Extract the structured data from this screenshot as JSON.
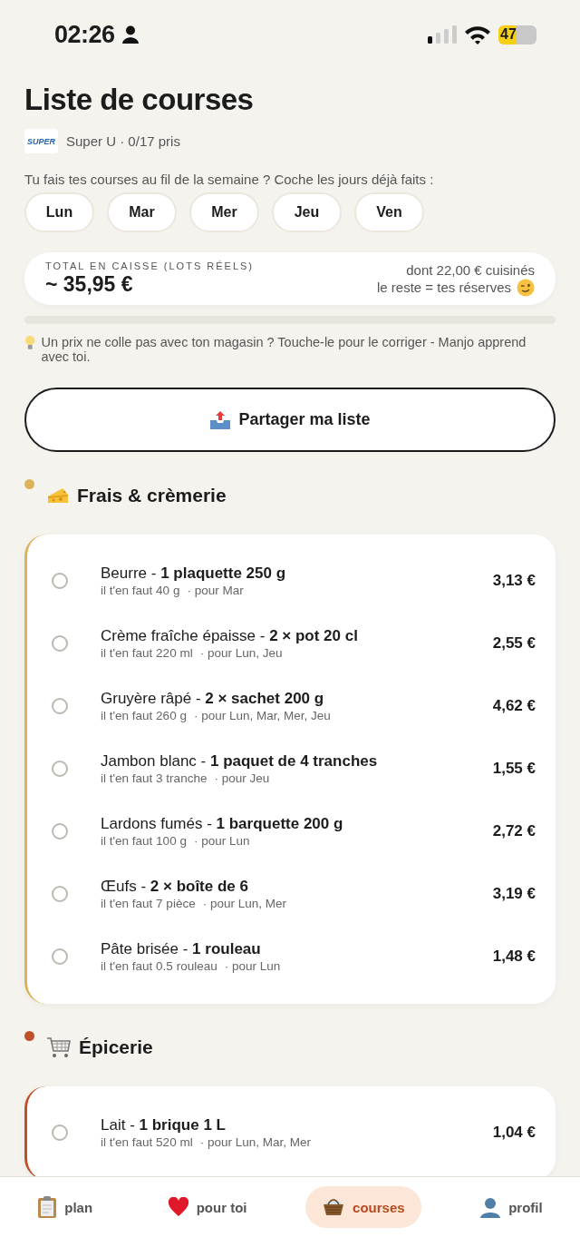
{
  "status_bar": {
    "time": "02:26",
    "battery": "47"
  },
  "title": "Liste de courses",
  "store": {
    "logo": "SUPER",
    "subtitle": "Super U · 0/17 pris"
  },
  "days_prompt": "Tu fais tes courses au fil de la semaine ? Coche les jours déjà faits :",
  "days": [
    {
      "label": "Lun",
      "selected": false
    },
    {
      "label": "Mar",
      "selected": false
    },
    {
      "label": "Mer",
      "selected": false
    },
    {
      "label": "Jeu",
      "selected": false
    },
    {
      "label": "Ven",
      "selected": false
    }
  ],
  "total": {
    "label": "TOTAL EN CAISSE (LOTS RÉELS)",
    "amount": "~ 35,95 €",
    "cooked": "dont 22,00 € cuisinés",
    "rest": "le reste = tes réserves"
  },
  "progress": {
    "level": 0
  },
  "tip": "Un prix ne colle pas avec ton magasin ? Touche-le pour le corriger - Manjo apprend avec toi.",
  "share_button": "Partager ma liste",
  "sections": [
    {
      "title": "Frais & crèmerie",
      "kind": "cheese",
      "color": "#dcb35a",
      "items": [
        {
          "name": "Beurre - **1 plaquette 250 g**",
          "need": "il t'en faut 40 g",
          "days": "· pour Mar",
          "price": "3,13 €",
          "checked": false
        },
        {
          "name": "Crème fraîche épaisse - **2 × pot 20 cl**",
          "need": "il t'en faut 220 ml",
          "days": "· pour Lun, Jeu",
          "price": "2,55 €",
          "checked": false
        },
        {
          "name": "Gruyère râpé - **2 × sachet 200 g**",
          "need": "il t'en faut 260 g",
          "days": "· pour Lun, Mar, Mer, Jeu",
          "price": "4,62 €",
          "checked": false
        },
        {
          "name": "Jambon blanc - **1 paquet de 4 tranches**",
          "need": "il t'en faut 3 tranche",
          "days": "· pour Jeu",
          "price": "1,55 €",
          "checked": false
        },
        {
          "name": "Lardons fumés - **1 barquette 200 g**",
          "need": "il t'en faut 100 g",
          "days": "· pour Lun",
          "price": "2,72 €",
          "checked": false
        },
        {
          "name": "Œufs - **2 × boîte de 6**",
          "need": "il t'en faut 7 pièce",
          "days": "· pour Lun, Mer",
          "price": "3,19 €",
          "checked": false
        },
        {
          "name": "Pâte brisée - **1 rouleau**",
          "need": "il t'en faut 0.5 rouleau",
          "days": "· pour Lun",
          "price": "1,48 €",
          "checked": false
        }
      ]
    },
    {
      "title": "Épicerie",
      "kind": "cart",
      "color": "#c0502a",
      "items": [
        {
          "name": "Lait - **1 brique 1 L**",
          "need": "il t'en faut 520 ml",
          "days": "· pour Lun, Mar, Mer",
          "price": "1,04 €",
          "checked": false
        }
      ]
    }
  ],
  "nav": [
    {
      "label": "plan",
      "kind": "clipboard",
      "selected": false
    },
    {
      "label": "pour toi",
      "kind": "heart",
      "selected": false
    },
    {
      "label": "courses",
      "kind": "basket",
      "selected": true
    },
    {
      "label": "profil",
      "kind": "person",
      "selected": false
    }
  ]
}
